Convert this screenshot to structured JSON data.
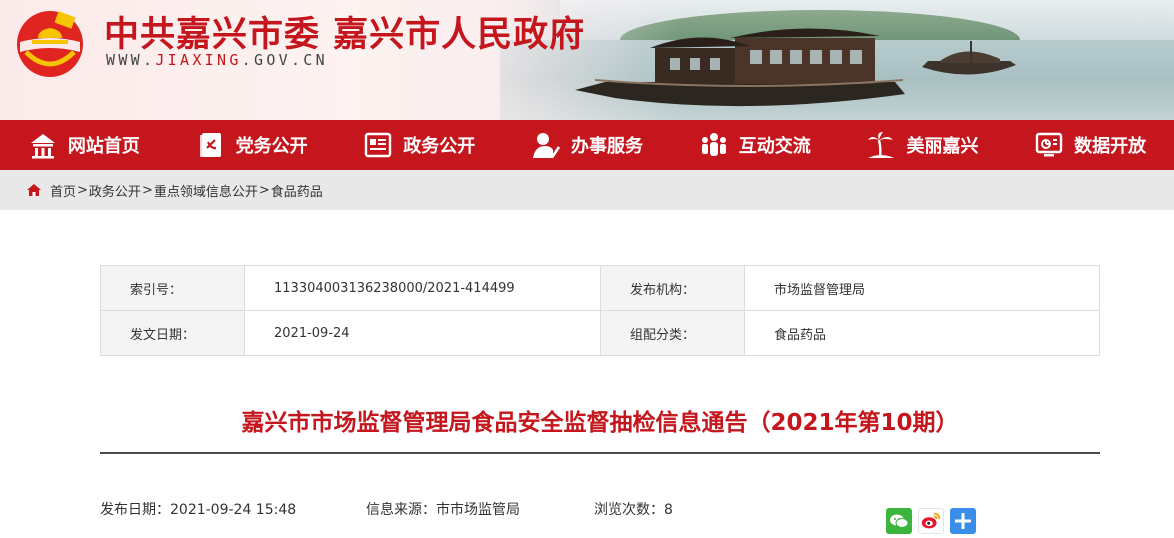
{
  "header": {
    "title": "中共嘉兴市委 嘉兴市人民政府",
    "url_prefix": "WWW.",
    "url_highlight": "JIAXING",
    "url_suffix": ".GOV.CN"
  },
  "nav": [
    {
      "label": "网站首页",
      "icon": "home-icon"
    },
    {
      "label": "党务公开",
      "icon": "party-book-icon"
    },
    {
      "label": "政务公开",
      "icon": "gov-panel-icon"
    },
    {
      "label": "办事服务",
      "icon": "service-person-icon"
    },
    {
      "label": "互动交流",
      "icon": "people-group-icon"
    },
    {
      "label": "美丽嘉兴",
      "icon": "palm-tree-icon"
    },
    {
      "label": "数据开放",
      "icon": "data-screen-icon"
    }
  ],
  "breadcrumb": {
    "home": "首页",
    "items": [
      "政务公开",
      "重点领域信息公开",
      "食品药品"
    ],
    "separator": ">"
  },
  "info_table": {
    "index_label": "索引号：",
    "index_value": "113304003136238000/2021-414499",
    "org_label": "发布机构：",
    "org_value": "市场监督管理局",
    "date_label": "发文日期：",
    "date_value": "2021-09-24",
    "category_label": "组配分类：",
    "category_value": "食品药品"
  },
  "article": {
    "title": "嘉兴市市场监督管理局食品安全监督抽检信息通告（2021年第10期）",
    "publish_label": "发布日期：",
    "publish_value": "2021-09-24 15:48",
    "source_label": "信息来源：",
    "source_value": "市市场监管局",
    "views_label": "浏览次数：",
    "views_value": "8"
  },
  "share": [
    "wechat-share-icon",
    "weibo-share-icon",
    "more-share-icon"
  ],
  "colors": {
    "brand_red": "#c4161c",
    "breadcrumb_bg": "#e8e8e8"
  }
}
